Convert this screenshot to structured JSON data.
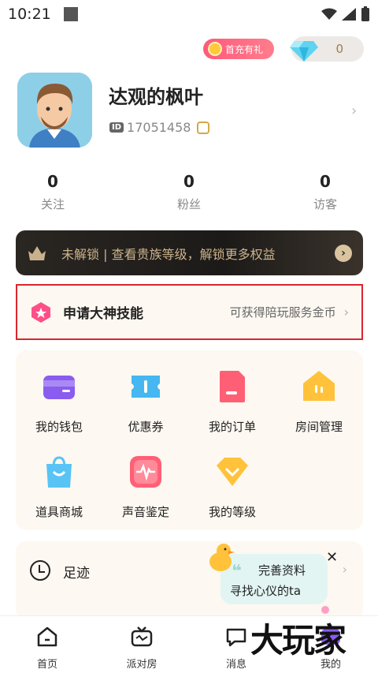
{
  "status_bar": {
    "time": "10:21"
  },
  "header": {
    "gift_label": "首充有礼",
    "diamond_value": "0"
  },
  "profile": {
    "name": "达观的枫叶",
    "id_badge": "ID",
    "id_value": "17051458"
  },
  "stats": [
    {
      "num": "0",
      "label": "关注"
    },
    {
      "num": "0",
      "label": "粉丝"
    },
    {
      "num": "0",
      "label": "访客"
    }
  ],
  "noble_banner": {
    "text": "未解锁 | 查看贵族等级，解锁更多权益"
  },
  "skill": {
    "title": "申请大神技能",
    "subtitle": "可获得陪玩服务金币"
  },
  "grid": [
    {
      "label": "我的钱包",
      "icon": "wallet-icon"
    },
    {
      "label": "优惠券",
      "icon": "coupon-icon"
    },
    {
      "label": "我的订单",
      "icon": "order-icon"
    },
    {
      "label": "房间管理",
      "icon": "room-icon"
    },
    {
      "label": "道具商城",
      "icon": "shop-bag-icon"
    },
    {
      "label": "声音鉴定",
      "icon": "voice-icon"
    },
    {
      "label": "我的等级",
      "icon": "level-icon"
    }
  ],
  "footprint": {
    "label": "足迹"
  },
  "promo": {
    "line1": "完善资料",
    "line2": "寻找心仪的ta"
  },
  "nav": [
    {
      "label": "首页",
      "icon": "home-icon"
    },
    {
      "label": "派对房",
      "icon": "tv-icon"
    },
    {
      "label": "消息",
      "icon": "message-icon"
    },
    {
      "label": "我的",
      "icon": "profile-icon"
    }
  ],
  "watermark": "大玩家",
  "colors": {
    "alert_border": "#d9262e",
    "card_bg": "#fdf8f1",
    "noble_bg": "#1c1a18",
    "gold_text": "#cbb38c"
  }
}
